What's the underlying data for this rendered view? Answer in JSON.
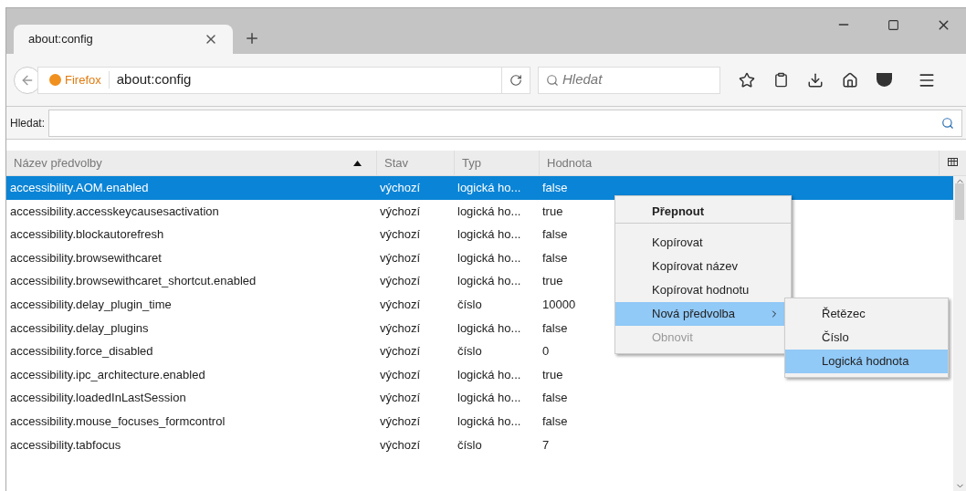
{
  "tab": {
    "title": "about:config"
  },
  "address_bar": {
    "identity": "Firefox",
    "url": "about:config"
  },
  "search_box": {
    "placeholder": "Hledat"
  },
  "filter": {
    "label": "Hledat:"
  },
  "columns": [
    {
      "label": "Název předvolby",
      "sorted": true
    },
    {
      "label": "Stav",
      "sorted": false
    },
    {
      "label": "Typ",
      "sorted": false
    },
    {
      "label": "Hodnota",
      "sorted": false
    }
  ],
  "rows": [
    {
      "name": "accessibility.AOM.enabled",
      "status": "výchozí",
      "type": "logická ho...",
      "value": "false",
      "selected": true
    },
    {
      "name": "accessibility.accesskeycausesactivation",
      "status": "výchozí",
      "type": "logická ho...",
      "value": "true",
      "selected": false
    },
    {
      "name": "accessibility.blockautorefresh",
      "status": "výchozí",
      "type": "logická ho...",
      "value": "false",
      "selected": false
    },
    {
      "name": "accessibility.browsewithcaret",
      "status": "výchozí",
      "type": "logická ho...",
      "value": "false",
      "selected": false
    },
    {
      "name": "accessibility.browsewithcaret_shortcut.enabled",
      "status": "výchozí",
      "type": "logická ho...",
      "value": "true",
      "selected": false
    },
    {
      "name": "accessibility.delay_plugin_time",
      "status": "výchozí",
      "type": "číslo",
      "value": "10000",
      "selected": false
    },
    {
      "name": "accessibility.delay_plugins",
      "status": "výchozí",
      "type": "logická ho...",
      "value": "false",
      "selected": false
    },
    {
      "name": "accessibility.force_disabled",
      "status": "výchozí",
      "type": "číslo",
      "value": "0",
      "selected": false
    },
    {
      "name": "accessibility.ipc_architecture.enabled",
      "status": "výchozí",
      "type": "logická ho...",
      "value": "true",
      "selected": false
    },
    {
      "name": "accessibility.loadedInLastSession",
      "status": "výchozí",
      "type": "logická ho...",
      "value": "false",
      "selected": false
    },
    {
      "name": "accessibility.mouse_focuses_formcontrol",
      "status": "výchozí",
      "type": "logická ho...",
      "value": "false",
      "selected": false
    },
    {
      "name": "accessibility.tabfocus",
      "status": "výchozí",
      "type": "číslo",
      "value": "7",
      "selected": false
    }
  ],
  "context_menu": {
    "items": [
      {
        "label": "Přepnout",
        "default": true,
        "disabled": false,
        "selected": false,
        "submenu": false,
        "separator_after": true
      },
      {
        "label": "Kopírovat",
        "default": false,
        "disabled": false,
        "selected": false,
        "submenu": false,
        "separator_after": false
      },
      {
        "label": "Kopírovat název",
        "default": false,
        "disabled": false,
        "selected": false,
        "submenu": false,
        "separator_after": false
      },
      {
        "label": "Kopírovat hodnotu",
        "default": false,
        "disabled": false,
        "selected": false,
        "submenu": false,
        "separator_after": false
      },
      {
        "label": "Nová předvolba",
        "default": false,
        "disabled": false,
        "selected": true,
        "submenu": true,
        "separator_after": false
      },
      {
        "label": "Obnovit",
        "default": false,
        "disabled": true,
        "selected": false,
        "submenu": false,
        "separator_after": false
      }
    ]
  },
  "submenu": {
    "items": [
      {
        "label": "Řetězec",
        "selected": false
      },
      {
        "label": "Číslo",
        "selected": false
      },
      {
        "label": "Logická hodnota",
        "selected": true
      }
    ]
  }
}
